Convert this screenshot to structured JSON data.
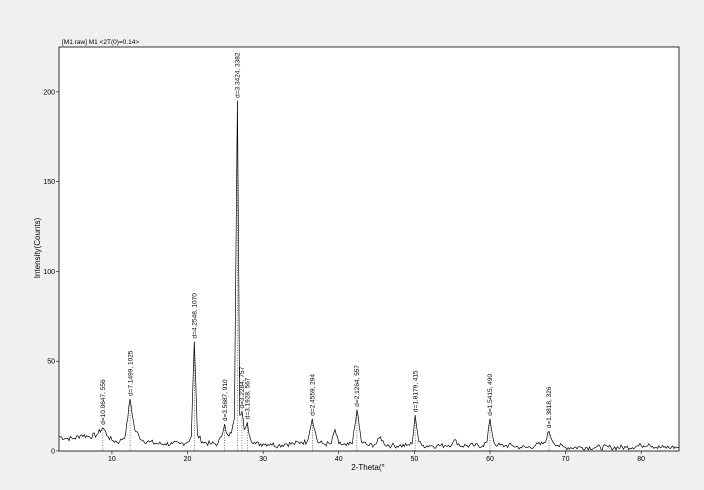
{
  "chart_data": {
    "type": "line",
    "header": "[M1.raw] M1 <2T(0)=0.14>",
    "xlabel": "2-Theta(°",
    "ylabel": "Intensity(Counts)",
    "xlim": [
      3,
      85
    ],
    "ylim": [
      0,
      225
    ],
    "x_ticks": [
      10,
      20,
      30,
      40,
      50,
      60,
      70,
      80
    ],
    "y_ticks": [
      0,
      50,
      100,
      150,
      200
    ],
    "colors": {
      "background": "#f0f0f0",
      "plot": "#ffffff",
      "trace": "#000000"
    },
    "peaks": [
      {
        "x": 8.8,
        "y": 13,
        "label": "d=10.0647, 556"
      },
      {
        "x": 12.4,
        "y": 29,
        "label": "d=7.1499, 1025"
      },
      {
        "x": 20.9,
        "y": 61,
        "label": "d=4.2548, 1070"
      },
      {
        "x": 24.9,
        "y": 15,
        "label": "d=3.5687, 910"
      },
      {
        "x": 26.6,
        "y": 195,
        "label": "d=3.3424, 3382"
      },
      {
        "x": 27.2,
        "y": 22,
        "label": "d=3.2284, 757"
      },
      {
        "x": 27.9,
        "y": 16,
        "label": "d=3.1928, 567"
      },
      {
        "x": 36.5,
        "y": 18,
        "label": "d=2.4559, 294"
      },
      {
        "x": 42.4,
        "y": 23,
        "label": "d=2.1264, 557"
      },
      {
        "x": 50.1,
        "y": 20,
        "label": "d=1.8179, 415"
      },
      {
        "x": 60.0,
        "y": 18,
        "label": "d=1.5415, 490"
      },
      {
        "x": 67.8,
        "y": 11,
        "label": "d=1.3818, 326"
      }
    ],
    "series": [
      {
        "x": [
          3,
          4,
          5,
          6,
          7,
          8,
          8.8,
          9.5,
          10,
          11,
          11.8,
          12.4,
          13,
          14,
          15,
          16,
          17,
          18,
          19,
          20,
          20.5,
          20.9,
          21.3,
          22,
          23,
          24,
          24.5,
          24.9,
          25.3,
          25.8,
          26.2,
          26.6,
          26.9,
          27.2,
          27.5,
          27.9,
          28.3,
          29,
          30,
          31,
          32,
          33,
          34,
          35,
          35.8,
          36.5,
          37.2,
          38,
          39,
          39.5,
          40,
          41,
          41.8,
          42.4,
          43,
          44,
          45,
          45.5,
          46,
          47,
          48,
          49,
          49.7,
          50.1,
          50.6,
          51,
          52,
          53,
          54,
          55,
          55.5,
          56,
          57,
          58,
          59,
          59.6,
          60,
          60.5,
          61,
          62,
          63,
          64,
          65,
          66,
          67,
          67.5,
          67.8,
          68.2,
          69,
          70,
          72,
          74,
          76,
          78,
          80,
          81,
          82,
          83,
          84,
          85
        ],
        "y": [
          8,
          7,
          7,
          9,
          8,
          9,
          13,
          8,
          6,
          5,
          9,
          29,
          12,
          6,
          5,
          4,
          4,
          4,
          4,
          5,
          8,
          61,
          9,
          5,
          4,
          4,
          8,
          15,
          9,
          10,
          18,
          195,
          20,
          22,
          12,
          16,
          7,
          4,
          4,
          4,
          3,
          4,
          4,
          5,
          5,
          18,
          5,
          4,
          4,
          12,
          4,
          3,
          4,
          23,
          5,
          3,
          4,
          8,
          4,
          3,
          3,
          3,
          4,
          20,
          5,
          3,
          3,
          3,
          3,
          4,
          6,
          3,
          3,
          3,
          3,
          5,
          18,
          5,
          3,
          3,
          3,
          2,
          2,
          3,
          4,
          7,
          11,
          6,
          3,
          2,
          2,
          2,
          2,
          2,
          3,
          4,
          2,
          2,
          2,
          2
        ]
      }
    ]
  }
}
